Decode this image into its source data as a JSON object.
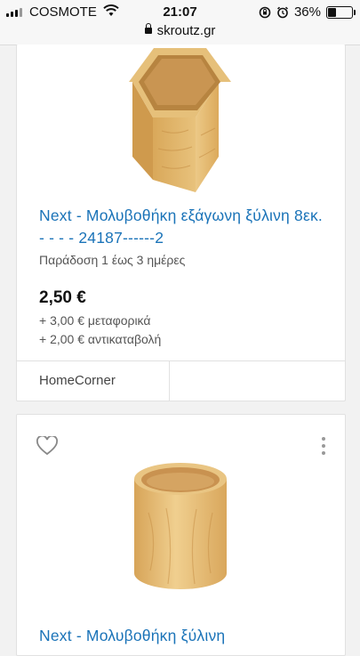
{
  "status_bar": {
    "carrier": "COSMOTE",
    "time": "21:07",
    "battery_percent": "36%",
    "battery_level": 0.36,
    "url": "skroutz.gr"
  },
  "products": [
    {
      "title": "Next - Μολυβοθήκη εξάγωνη ξύλινη 8εκ. - - - - 24187------2",
      "delivery": "Παράδοση 1 έως 3 ημέρες",
      "price": "2,50 €",
      "shipping": "+ 3,00 € μεταφορικά",
      "cod": "+ 2,00 € αντικαταβολή",
      "shop": "HomeCorner",
      "image_icon": "hexagonal-wooden-pencil-holder"
    },
    {
      "title": "Next - Μολυβοθήκη ξύλινη",
      "image_icon": "round-wooden-pencil-holder",
      "favorite_icon": "heart-icon",
      "menu_icon": "more-vertical-icon"
    }
  ],
  "colors": {
    "link": "#1a73b8",
    "wood": "#e2b86d"
  }
}
